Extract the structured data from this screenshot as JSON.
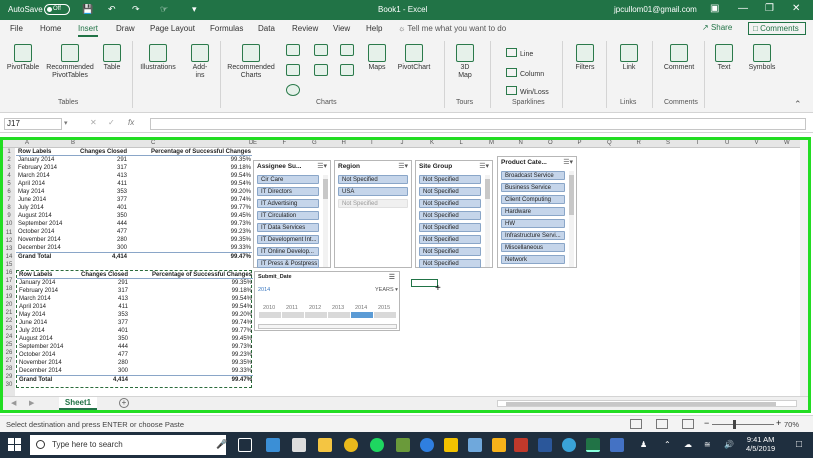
{
  "titlebar": {
    "autosave_label": "AutoSave",
    "autosave_state": "Off",
    "title": "Book1 - Excel",
    "account": "jpcullom01@gmail.com"
  },
  "menu": {
    "tabs": [
      "File",
      "Home",
      "Insert",
      "Draw",
      "Page Layout",
      "Formulas",
      "Data",
      "Review",
      "View",
      "Help"
    ],
    "active_tab": "Insert",
    "tell_me": "Tell me what you want to do",
    "share": "Share",
    "comments": "Comments"
  },
  "ribbon": {
    "pivot_table": "PivotTable",
    "recommended_pivot": "Recommended\nPivotTables",
    "table": "Table",
    "illustrations": "Illustrations",
    "addins": "Add-\nins",
    "recommended_charts": "Recommended\nCharts",
    "maps": "Maps",
    "pivot_chart": "PivotChart",
    "map3d": "3D\nMap",
    "line": "Line",
    "column": "Column",
    "winloss": "Win/Loss",
    "filters": "Filters",
    "link": "Link",
    "comment": "Comment",
    "text": "Text",
    "symbols": "Symbols",
    "group_tables": "Tables",
    "group_charts": "Charts",
    "group_tours": "Tours",
    "group_sparklines": "Sparklines",
    "group_links": "Links",
    "group_comments": "Comments"
  },
  "formula_bar": {
    "name_box": "J17",
    "fx": "fx",
    "value": ""
  },
  "columns": [
    "A",
    "B",
    "C",
    "D",
    "E",
    "F",
    "G",
    "H",
    "I",
    "J",
    "K",
    "L",
    "M",
    "N",
    "O",
    "P",
    "Q",
    "R",
    "S",
    "T",
    "U",
    "V",
    "W"
  ],
  "rows": [
    "1",
    "2",
    "3",
    "4",
    "5",
    "6",
    "7",
    "8",
    "9",
    "10",
    "11",
    "12",
    "13",
    "14",
    "15",
    "16",
    "17",
    "18",
    "19",
    "20",
    "21",
    "22",
    "23",
    "24",
    "25",
    "26",
    "27",
    "28",
    "29",
    "30"
  ],
  "pivot_headers": [
    "Row Labels",
    "Changes Closed",
    "Percentage of Successful Changes"
  ],
  "pivot_rows": [
    [
      "January 2014",
      "291",
      "99.35%"
    ],
    [
      "February 2014",
      "317",
      "99.18%"
    ],
    [
      "March 2014",
      "413",
      "99.54%"
    ],
    [
      "April 2014",
      "411",
      "99.54%"
    ],
    [
      "May 2014",
      "353",
      "99.20%"
    ],
    [
      "June 2014",
      "377",
      "99.74%"
    ],
    [
      "July 2014",
      "401",
      "99.77%"
    ],
    [
      "August 2014",
      "350",
      "99.45%"
    ],
    [
      "September 2014",
      "444",
      "99.73%"
    ],
    [
      "October 2014",
      "477",
      "99.23%"
    ],
    [
      "November 2014",
      "280",
      "99.35%"
    ],
    [
      "December 2014",
      "300",
      "99.33%"
    ]
  ],
  "pivot_total": [
    "Grand Total",
    "4,414",
    "99.47%"
  ],
  "pivot2_rows": [
    [
      "January 2014",
      "291",
      "99.35%"
    ],
    [
      "February 2014",
      "317",
      "99.18%"
    ],
    [
      "March 2014",
      "413",
      "99.54%"
    ],
    [
      "April 2014",
      "411",
      "99.54%"
    ],
    [
      "May 2014",
      "353",
      "99.20%"
    ],
    [
      "June 2014",
      "377",
      "99.74%"
    ],
    [
      "July 2014",
      "401",
      "99.77%"
    ],
    [
      "August 2014",
      "350",
      "99.45%"
    ],
    [
      "September 2014",
      "444",
      "99.73%"
    ],
    [
      "October 2014",
      "477",
      "99.23%"
    ],
    [
      "November 2014",
      "280",
      "99.35%"
    ],
    [
      "December 2014",
      "300",
      "99.33%"
    ]
  ],
  "slicers": {
    "assignee": {
      "title": "Assignee Su...",
      "items": [
        "Cir Care",
        "IT Directors",
        "IT Advertising",
        "IT Circulation",
        "IT Data Services",
        "IT Development Int...",
        "IT Online Develop...",
        "IT Press & Postpress"
      ]
    },
    "region": {
      "title": "Region",
      "items": [
        "Not Specified",
        "USA",
        "Not Specified"
      ]
    },
    "site_group": {
      "title": "Site Group",
      "items": [
        "Not Specified",
        "Not Specified",
        "Not Specified",
        "Not Specified",
        "Not Specified",
        "Not Specified",
        "Not Specified",
        "Not Specified"
      ]
    },
    "product_cat": {
      "title": "Product Cate...",
      "items": [
        "Broadcast Service",
        "Business Service",
        "Client Computing",
        "Hardware",
        "HW",
        "Infrastructure Servi...",
        "Miscellaneous",
        "Network"
      ]
    }
  },
  "timeline": {
    "title": "Submit_Date",
    "selected": "2014",
    "level": "YEARS",
    "years": [
      "2010",
      "2011",
      "2012",
      "2013",
      "2014",
      "2015"
    ],
    "selected_index": 4
  },
  "sheet": {
    "tab": "Sheet1",
    "status": "Select destination and press ENTER or choose Paste",
    "zoom": "70%"
  },
  "taskbar": {
    "search_placeholder": "Type here to search",
    "time": "9:41 AM",
    "date": "4/5/2019"
  },
  "colors": {
    "excel_green": "#217346",
    "selection_border": "#22dd22",
    "slicer_selected": "#c5d5ea",
    "taskbar": "#1f2f3f"
  }
}
